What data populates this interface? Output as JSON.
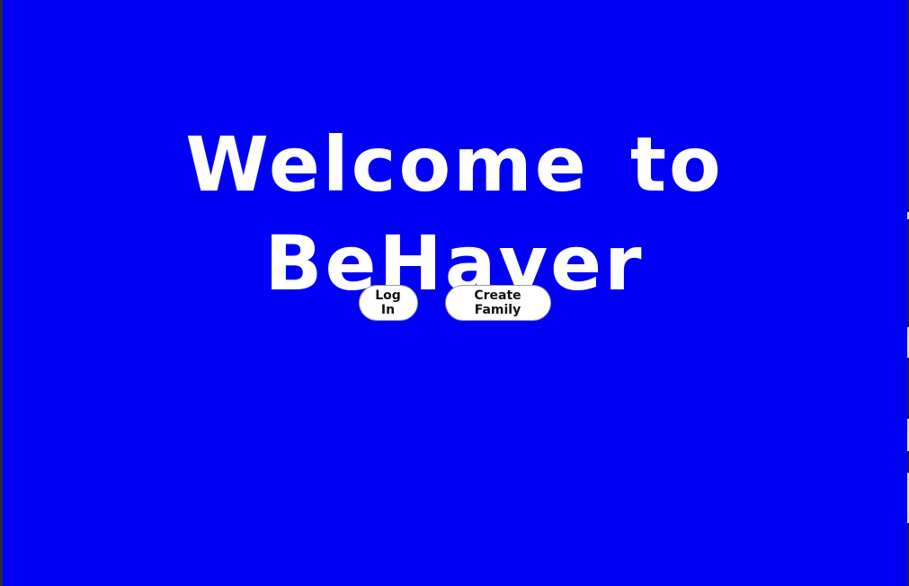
{
  "app": {
    "background_color": "#0000f5",
    "accent_text_color": "#ffffff"
  },
  "welcome": {
    "title": "Welcome to BeHaver"
  },
  "actions": {
    "login_label": "Log In",
    "create_family_label": "Create Family"
  }
}
